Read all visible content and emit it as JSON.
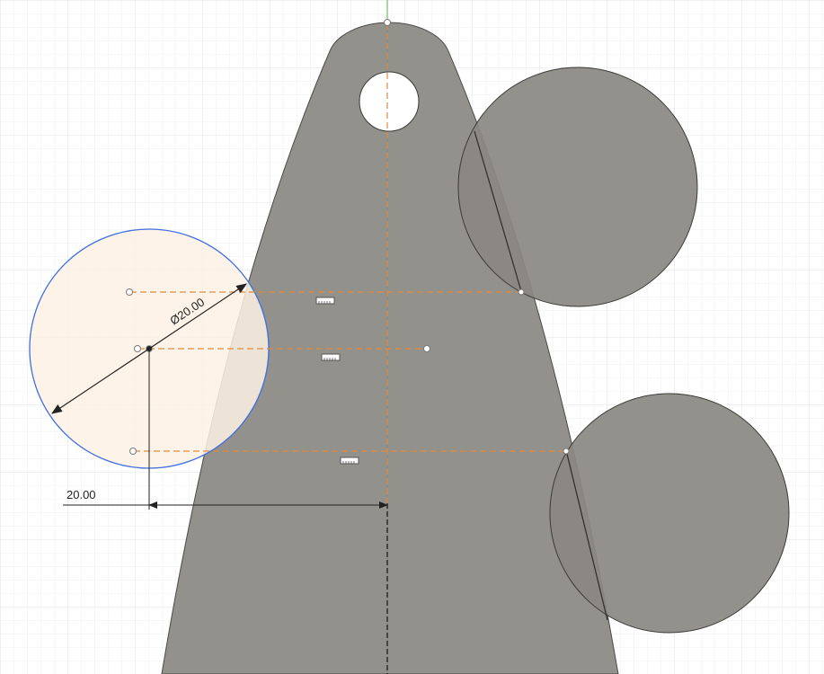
{
  "app": {
    "view": "sketch-canvas"
  },
  "colors": {
    "background": "#ffffff",
    "grid_minor": "#eef0f2",
    "grid_major": "#dde1e4",
    "profile_fill": "#8a8882",
    "profile_stroke": "#4a4a46",
    "selected_circle_fill": "#fdf1e4",
    "selected_circle_stroke": "#3f6fe0",
    "construction_line": "#e08a3c",
    "axis_green": "#53b64b",
    "dimension": "#222222"
  },
  "dimensions": {
    "diameter_label": "Ø20.00",
    "linear_label": "20.00"
  },
  "icons": {
    "constraint": "horizontal-constraint-icon"
  }
}
